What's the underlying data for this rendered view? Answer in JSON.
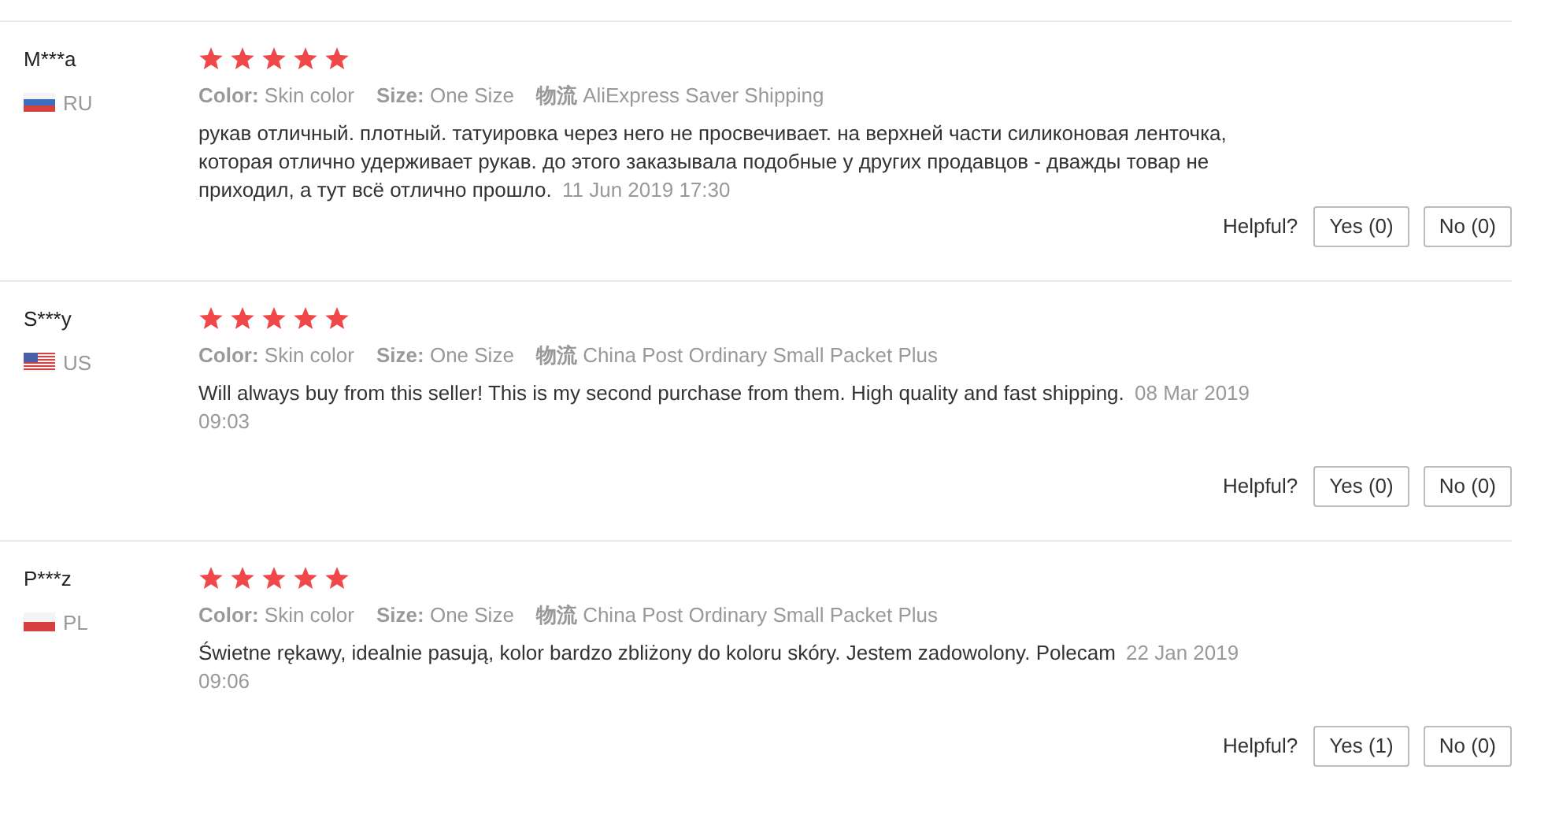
{
  "reviews": [
    {
      "user": "M***a",
      "kind": "ru",
      "country": "RU",
      "stars": 5,
      "color_label": "Color:",
      "color_value": "Skin color",
      "size_label": "Size:",
      "size": "One Size",
      "shipping_label": "物流",
      "shipping": "AliExpress Saver Shipping",
      "text": "рукав отличный. плотный. татуировка через него не просвечивает. на верхней части силиконовая ленточка, которая отлично удерживает рукав. до этого заказывала подобные у других продавцов - дважды товар не приходил, а тут всё отлично прошло.",
      "date": "11 Jun 2019 17:30",
      "helpful": "Helpful?",
      "yes": "Yes (0)",
      "no": "No (0)"
    },
    {
      "user": "S***y",
      "kind": "us",
      "country": "US",
      "stars": 5,
      "color_label": "Color:",
      "color_value": "Skin color",
      "size_label": "Size:",
      "size": "One Size",
      "shipping_label": "物流",
      "shipping": "China Post Ordinary Small Packet Plus",
      "text": "Will always buy from this seller! This is my second purchase from them. High quality and fast shipping.",
      "date": "08 Mar 2019 09:03",
      "helpful": "Helpful?",
      "yes": "Yes (0)",
      "no": "No (0)"
    },
    {
      "user": "P***z",
      "kind": "pl",
      "country": "PL",
      "stars": 5,
      "color_label": "Color:",
      "color_value": "Skin color",
      "size_label": "Size:",
      "size": "One Size",
      "shipping_label": "物流",
      "shipping": "China Post Ordinary Small Packet Plus",
      "text": "Świetne rękawy, idealnie pasują, kolor bardzo zbliżony do koloru skóry. Jestem zadowolony. Polecam",
      "date": "22 Jan 2019 09:06",
      "helpful": "Helpful?",
      "yes": "Yes (1)",
      "no": "No (0)"
    }
  ]
}
